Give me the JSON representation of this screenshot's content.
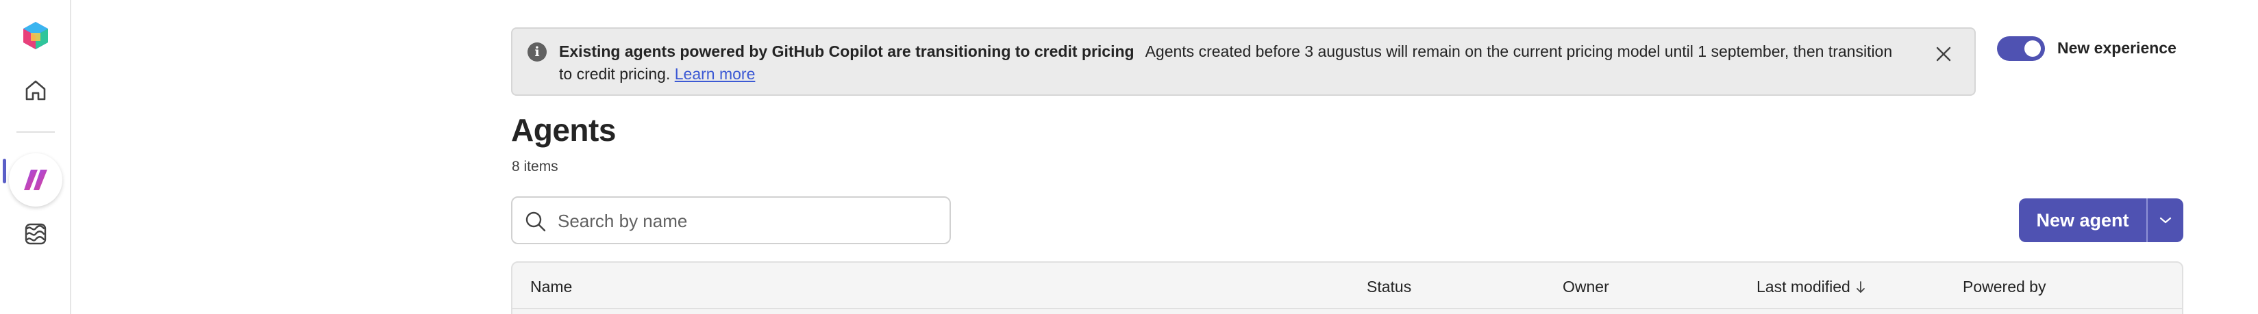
{
  "rail": {
    "items": [
      {
        "name": "copilot-studio-logo-icon"
      },
      {
        "name": "home-icon"
      },
      {
        "name": "agents-icon",
        "active": true
      },
      {
        "name": "flows-icon"
      }
    ],
    "accent_color": "#5b5fc7"
  },
  "banner": {
    "title": "Existing agents powered by GitHub Copilot are transitioning to credit pricing",
    "message": "Agents created before 3 augustus will remain on the current pricing model until 1 september, then transition to credit pricing.",
    "link_label": "Learn more",
    "info_glyph": "i",
    "close_icon": "close-icon"
  },
  "toggle": {
    "label": "New experience",
    "on": true,
    "color": "#4f52b2"
  },
  "page": {
    "title": "Agents",
    "item_count": "8 items"
  },
  "search": {
    "placeholder": "Search by name",
    "value": ""
  },
  "new_agent": {
    "label": "New agent",
    "color": "#4f52b2"
  },
  "table": {
    "columns": [
      {
        "label": "Name"
      },
      {
        "label": "Status"
      },
      {
        "label": "Owner"
      },
      {
        "label": "Last modified",
        "sort": "descending",
        "sort_icon": "arrow-down-icon"
      },
      {
        "label": "Powered by"
      }
    ]
  }
}
